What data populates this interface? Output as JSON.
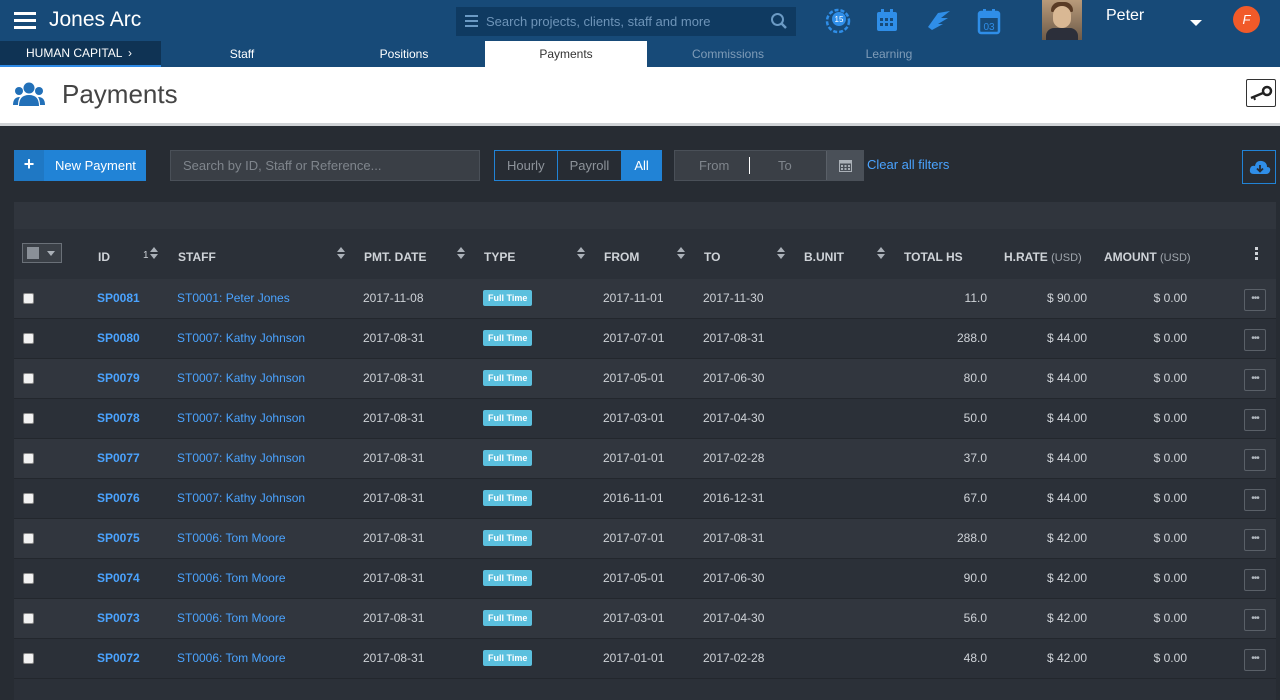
{
  "app": {
    "title": "Jones Arc"
  },
  "search": {
    "placeholder": "Search projects, clients, staff and more"
  },
  "user": {
    "name": "Peter"
  },
  "top_icons": [
    "history-icon",
    "calendar-icon",
    "wing-icon",
    "calendar-day-icon"
  ],
  "calendar_day": "03",
  "badge_icon_text": "15",
  "nav": {
    "section": "HUMAN CAPITAL",
    "tabs": [
      "Staff",
      "Positions",
      "Payments",
      "Commissions",
      "Learning"
    ],
    "active_tab": "Payments"
  },
  "page": {
    "title": "Payments"
  },
  "toolbar": {
    "new_button": "New Payment",
    "filter_placeholder": "Search by ID, Staff or Reference...",
    "segments": [
      "Hourly",
      "Payroll",
      "All"
    ],
    "active_segment": "All",
    "date_from": "From",
    "date_to": "To",
    "clear_filters": "Clear all filters"
  },
  "table": {
    "sort_rank": "1",
    "columns": {
      "id": "ID",
      "staff": "STAFF",
      "pmt_date": "PMT. DATE",
      "type": "TYPE",
      "from": "FROM",
      "to": "TO",
      "bunit": "B.UNIT",
      "total_hs": "TOTAL HS",
      "hrate": "H.RATE",
      "hrate_unit": "(USD)",
      "amount": "AMOUNT",
      "amount_unit": "(USD)"
    },
    "rows": [
      {
        "id": "SP0081",
        "staff": "ST0001: Peter Jones",
        "pmt_date": "2017-11-08",
        "type": "Full Time",
        "from": "2017-11-01",
        "to": "2017-11-30",
        "total_hs": "11.0",
        "hrate": "$ 90.00",
        "amount": "$ 0.00"
      },
      {
        "id": "SP0080",
        "staff": "ST0007: Kathy Johnson",
        "pmt_date": "2017-08-31",
        "type": "Full Time",
        "from": "2017-07-01",
        "to": "2017-08-31",
        "total_hs": "288.0",
        "hrate": "$ 44.00",
        "amount": "$ 0.00"
      },
      {
        "id": "SP0079",
        "staff": "ST0007: Kathy Johnson",
        "pmt_date": "2017-08-31",
        "type": "Full Time",
        "from": "2017-05-01",
        "to": "2017-06-30",
        "total_hs": "80.0",
        "hrate": "$ 44.00",
        "amount": "$ 0.00"
      },
      {
        "id": "SP0078",
        "staff": "ST0007: Kathy Johnson",
        "pmt_date": "2017-08-31",
        "type": "Full Time",
        "from": "2017-03-01",
        "to": "2017-04-30",
        "total_hs": "50.0",
        "hrate": "$ 44.00",
        "amount": "$ 0.00"
      },
      {
        "id": "SP0077",
        "staff": "ST0007: Kathy Johnson",
        "pmt_date": "2017-08-31",
        "type": "Full Time",
        "from": "2017-01-01",
        "to": "2017-02-28",
        "total_hs": "37.0",
        "hrate": "$ 44.00",
        "amount": "$ 0.00"
      },
      {
        "id": "SP0076",
        "staff": "ST0007: Kathy Johnson",
        "pmt_date": "2017-08-31",
        "type": "Full Time",
        "from": "2016-11-01",
        "to": "2016-12-31",
        "total_hs": "67.0",
        "hrate": "$ 44.00",
        "amount": "$ 0.00"
      },
      {
        "id": "SP0075",
        "staff": "ST0006: Tom Moore",
        "pmt_date": "2017-08-31",
        "type": "Full Time",
        "from": "2017-07-01",
        "to": "2017-08-31",
        "total_hs": "288.0",
        "hrate": "$ 42.00",
        "amount": "$ 0.00"
      },
      {
        "id": "SP0074",
        "staff": "ST0006: Tom Moore",
        "pmt_date": "2017-08-31",
        "type": "Full Time",
        "from": "2017-05-01",
        "to": "2017-06-30",
        "total_hs": "90.0",
        "hrate": "$ 42.00",
        "amount": "$ 0.00"
      },
      {
        "id": "SP0073",
        "staff": "ST0006: Tom Moore",
        "pmt_date": "2017-08-31",
        "type": "Full Time",
        "from": "2017-03-01",
        "to": "2017-04-30",
        "total_hs": "56.0",
        "hrate": "$ 42.00",
        "amount": "$ 0.00"
      },
      {
        "id": "SP0072",
        "staff": "ST0006: Tom Moore",
        "pmt_date": "2017-08-31",
        "type": "Full Time",
        "from": "2017-01-01",
        "to": "2017-02-28",
        "total_hs": "48.0",
        "hrate": "$ 42.00",
        "amount": "$ 0.00"
      }
    ]
  },
  "colors": {
    "topbar": "#174a78",
    "accent": "#2183d6",
    "link": "#4aa3ff",
    "badge": "#5bc0de",
    "notification": "#f15a29"
  }
}
